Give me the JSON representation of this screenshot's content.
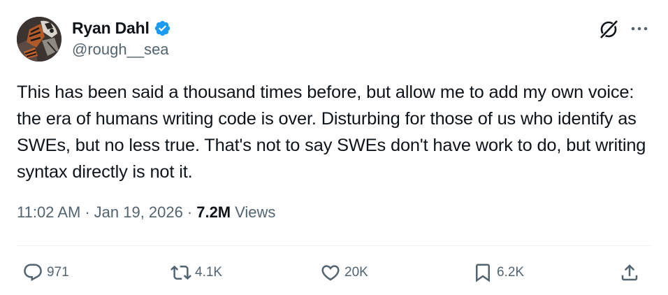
{
  "author": {
    "display_name": "Ryan Dahl",
    "handle": "@rough__sea",
    "verified": true,
    "avatar": "profile-picture"
  },
  "tweet": {
    "text": "This has been said a thousand times before, but allow me to add my own voice: the era of humans writing code is over. Disturbing for those of us who identify as SWEs, but no less true. That's not to say SWEs don't have work to do, but writing syntax directly is not it.",
    "time": "11:02 AM",
    "date": "Jan 19, 2026",
    "separator": "·",
    "views_count": "7.2M",
    "views_label": "Views"
  },
  "actions": {
    "replies": "971",
    "reposts": "4.1K",
    "likes": "20K",
    "bookmarks": "6.2K"
  },
  "icons": {
    "verified": "verified-badge-icon",
    "grok": "grok-icon",
    "more": "more-icon",
    "reply": "reply-icon",
    "repost": "repost-icon",
    "like": "heart-icon",
    "bookmark": "bookmark-icon",
    "share": "share-icon"
  },
  "colors": {
    "text": "#0f1419",
    "secondary": "#536471",
    "verified": "#1d9bf0",
    "divider": "#eff3f4"
  }
}
